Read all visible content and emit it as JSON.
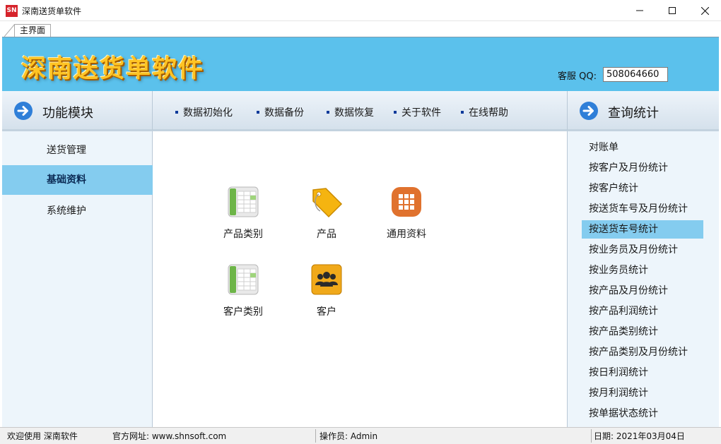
{
  "window": {
    "icon_text": "SN",
    "title": "深南送货单软件"
  },
  "tabs": [
    {
      "label": "主界面"
    }
  ],
  "banner": {
    "brand": "深南送货单软件",
    "qq_label": "客服 QQ:",
    "qq_value": "508064660"
  },
  "left_header": {
    "title": "功能模块"
  },
  "right_header": {
    "title": "查询统计"
  },
  "toolbar": [
    {
      "label": "数据初始化"
    },
    {
      "label": "数据备份"
    },
    {
      "label": "数据恢复"
    },
    {
      "label": "关于软件"
    },
    {
      "label": "在线帮助"
    }
  ],
  "sidebar": {
    "items": [
      {
        "label": "送货管理"
      },
      {
        "label": "基础资料",
        "active": true
      },
      {
        "label": "系统维护"
      }
    ]
  },
  "tiles": [
    {
      "label": "产品类别",
      "icon": "sheet-icon"
    },
    {
      "label": "产品",
      "icon": "tag-icon"
    },
    {
      "label": "通用资料",
      "icon": "grid-icon"
    },
    {
      "label": "客户类别",
      "icon": "sheet-icon"
    },
    {
      "label": "客户",
      "icon": "users-icon"
    }
  ],
  "stats": {
    "items": [
      {
        "label": "对账单"
      },
      {
        "label": "按客户及月份统计"
      },
      {
        "label": "按客户统计"
      },
      {
        "label": "按送货车号及月份统计"
      },
      {
        "label": "按送货车号统计",
        "active": true
      },
      {
        "label": "按业务员及月份统计"
      },
      {
        "label": "按业务员统计"
      },
      {
        "label": "按产品及月份统计"
      },
      {
        "label": "按产品利润统计"
      },
      {
        "label": "按产品类别统计"
      },
      {
        "label": "按产品类别及月份统计"
      },
      {
        "label": "按日利润统计"
      },
      {
        "label": "按月利润统计"
      },
      {
        "label": "按单据状态统计"
      }
    ]
  },
  "statusbar": {
    "welcome": "欢迎使用 深南软件",
    "website": "官方网址: www.shnsoft.com",
    "operator": "操作员: Admin",
    "date": "日期: 2021年03月04日"
  },
  "colors": {
    "banner": "#5bc1ec",
    "brand_text": "#ffc424",
    "highlight": "#84ccef",
    "panel_bg": "#edf5fb",
    "arrow": "#2f7fd8"
  }
}
